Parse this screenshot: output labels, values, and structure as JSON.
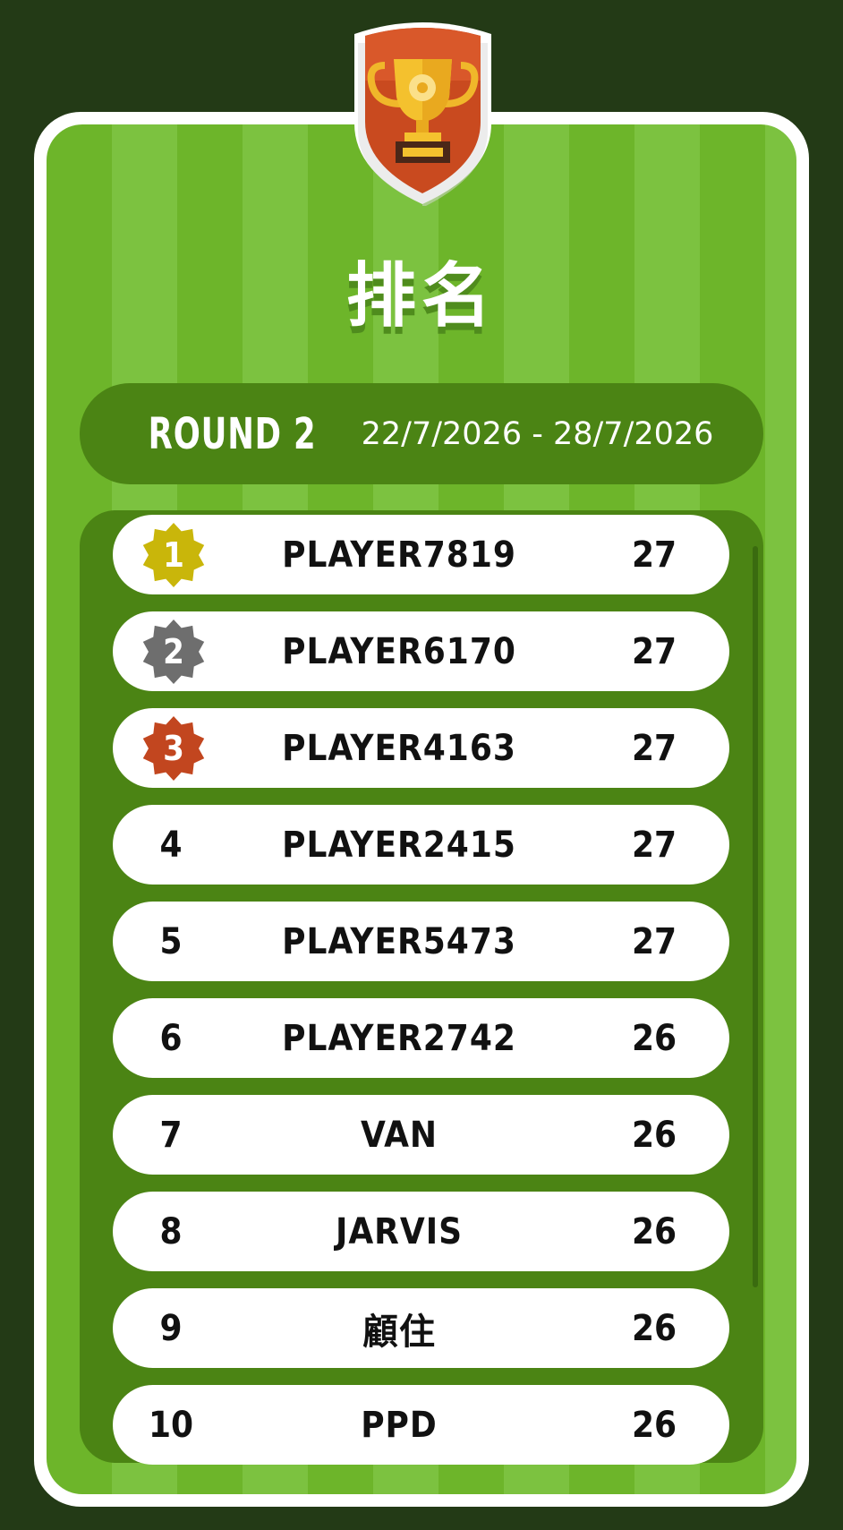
{
  "header": {
    "icon": "trophy-shield-icon",
    "title": "排名"
  },
  "round": {
    "label": "ROUND 2",
    "dates": "22/7/2026 - 28/7/2026"
  },
  "colors": {
    "gold": "#c9b60a",
    "silver": "#6e6e6e",
    "bronze": "#c2461f",
    "panel": "#4b8414",
    "field_light": "#7cc240",
    "field_dark": "#6db52a",
    "background": "#233a16"
  },
  "leaderboard": [
    {
      "rank": "1",
      "name": "PLAYER7819",
      "score": "27",
      "medal": "gold"
    },
    {
      "rank": "2",
      "name": "PLAYER6170",
      "score": "27",
      "medal": "silver"
    },
    {
      "rank": "3",
      "name": "PLAYER4163",
      "score": "27",
      "medal": "bronze"
    },
    {
      "rank": "4",
      "name": "PLAYER2415",
      "score": "27"
    },
    {
      "rank": "5",
      "name": "PLAYER5473",
      "score": "27"
    },
    {
      "rank": "6",
      "name": "PLAYER2742",
      "score": "26"
    },
    {
      "rank": "7",
      "name": "VAN",
      "score": "26"
    },
    {
      "rank": "8",
      "name": "JARVIS",
      "score": "26"
    },
    {
      "rank": "9",
      "name": "顧住",
      "score": "26"
    },
    {
      "rank": "10",
      "name": "PPD",
      "score": "26"
    }
  ]
}
